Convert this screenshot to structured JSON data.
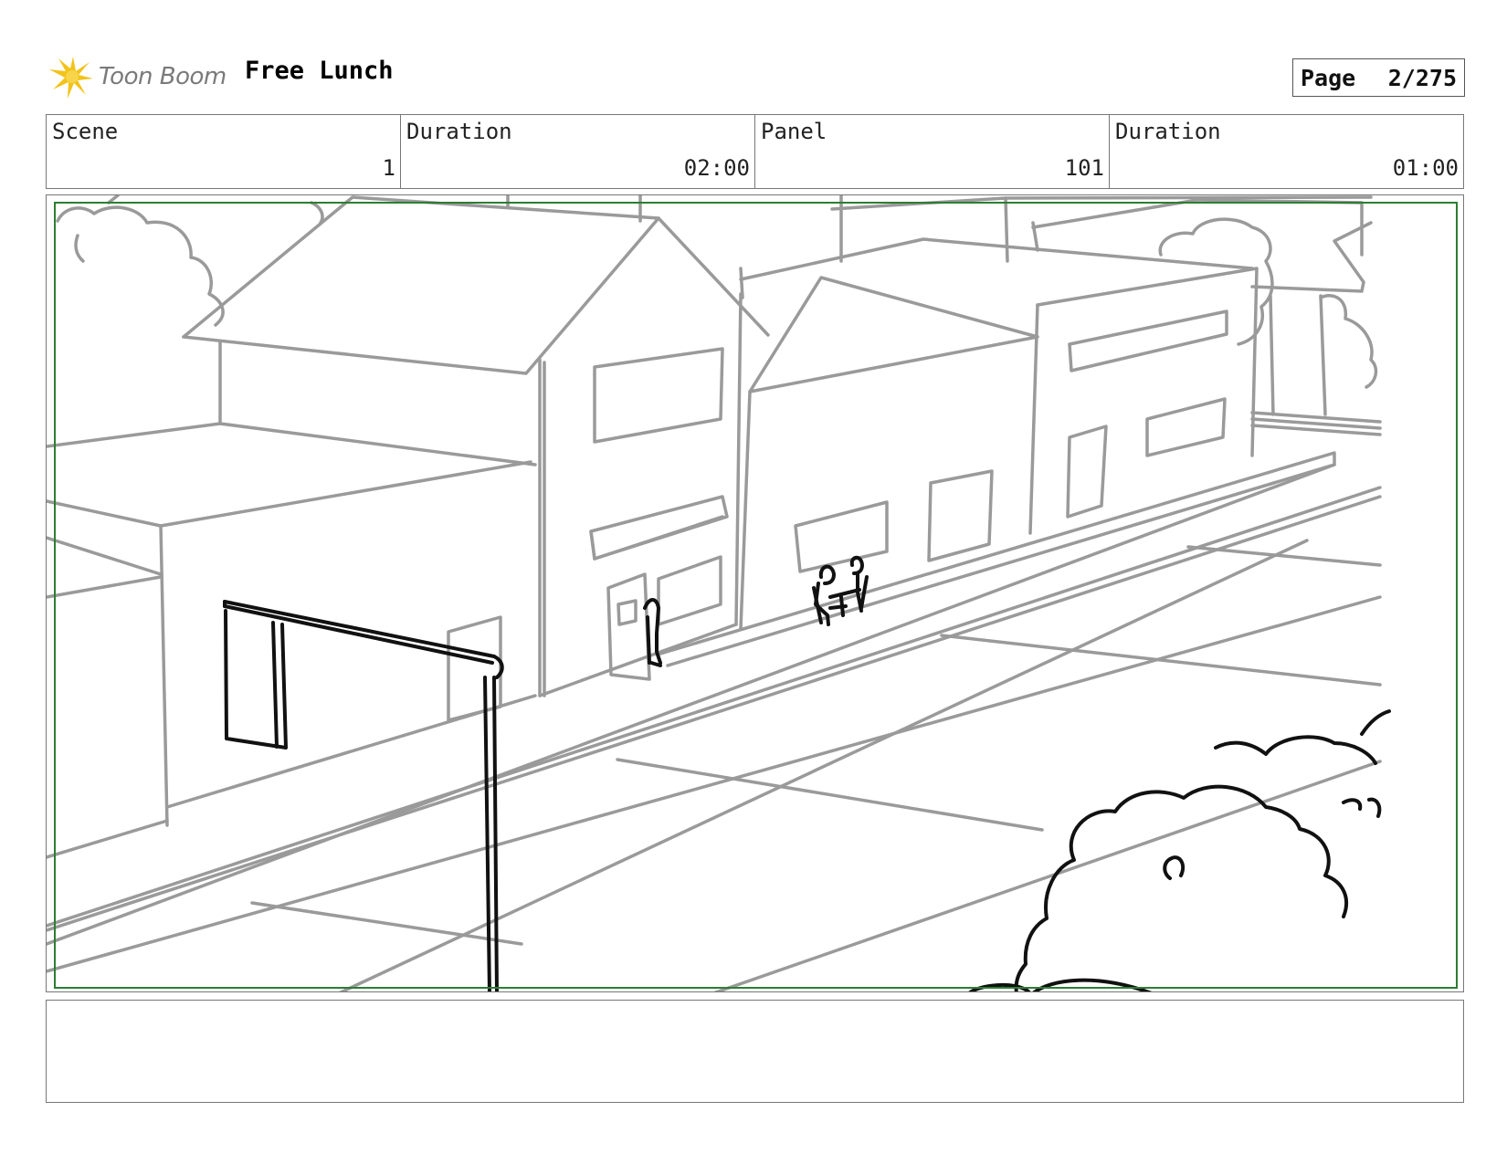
{
  "header": {
    "logo_text": "Toon Boom",
    "project_title": "Free Lunch",
    "page_label": "Page",
    "page_value": "2/275"
  },
  "info": {
    "scene_label": "Scene",
    "scene_value": "1",
    "scene_duration_label": "Duration",
    "scene_duration_value": "02:00",
    "panel_label": "Panel",
    "panel_value": "101",
    "panel_duration_label": "Duration",
    "panel_duration_value": "01:00"
  },
  "notes": {
    "text": ""
  },
  "colors": {
    "sketch_gray": "#9a9a9a",
    "ink_black": "#111111",
    "safe_frame_green": "#2e7d32",
    "logo_yellow": "#f2c318"
  }
}
